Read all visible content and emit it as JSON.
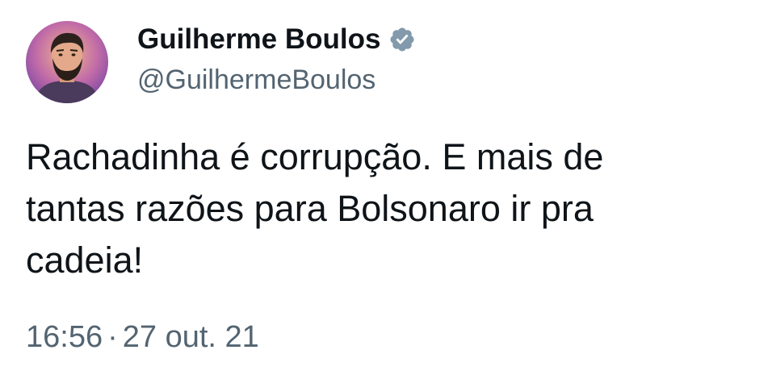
{
  "tweet": {
    "author": {
      "display_name": "Guilherme Boulos",
      "handle": "@GuilhermeBoulos",
      "verified_icon": "verified-badge-icon",
      "avatar": "illustrated-portrait-avatar"
    },
    "text_lines": [
      "Rachadinha é corrupção. E mais de",
      "tantas razões para Bolsonaro ir pra",
      "cadeia!"
    ],
    "time": "16:56",
    "separator": "·",
    "date": "27 out. 21"
  },
  "colors": {
    "text_primary": "#0f1419",
    "text_secondary": "#536471",
    "verified_badge": "#829aab",
    "background": "#ffffff"
  }
}
